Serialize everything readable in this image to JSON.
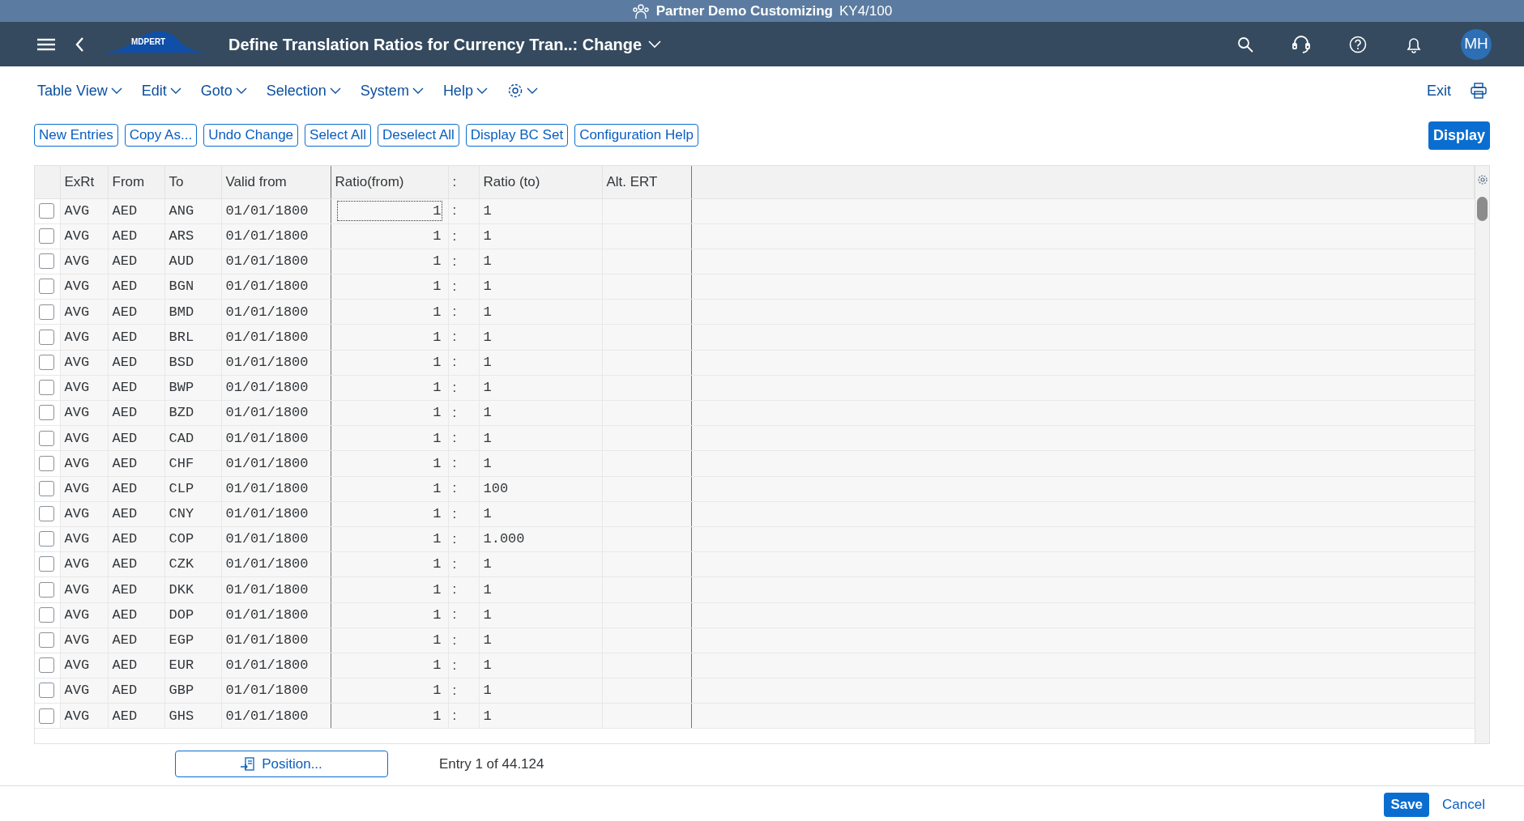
{
  "window": {
    "title": "Partner Demo Customizing",
    "system": "KY4/100"
  },
  "shell": {
    "logo": "MDPERT",
    "app_title": "Define Translation Ratios for Currency Tran..: Change",
    "avatar": "MH"
  },
  "menu": [
    "Table View",
    "Edit",
    "Goto",
    "Selection",
    "System",
    "Help"
  ],
  "exit": "Exit",
  "toolbar": [
    "New Entries",
    "Copy As...",
    "Undo Change",
    "Select All",
    "Deselect All",
    "Display BC Set",
    "Configuration Help"
  ],
  "display_button": "Display",
  "table": {
    "columns": [
      "ExRt",
      "From",
      "To",
      "Valid from",
      "Ratio(from)",
      ":",
      "Ratio (to)",
      "Alt. ERT"
    ],
    "rows": [
      {
        "selected": false,
        "focused": true,
        "cells": [
          "AVG",
          "AED",
          "ANG",
          "01/01/1800",
          "1",
          ":",
          "1",
          ""
        ]
      },
      {
        "selected": false,
        "focused": false,
        "cells": [
          "AVG",
          "AED",
          "ARS",
          "01/01/1800",
          "1",
          ":",
          "1",
          ""
        ]
      },
      {
        "selected": false,
        "focused": false,
        "cells": [
          "AVG",
          "AED",
          "AUD",
          "01/01/1800",
          "1",
          ":",
          "1",
          ""
        ]
      },
      {
        "selected": false,
        "focused": false,
        "cells": [
          "AVG",
          "AED",
          "BGN",
          "01/01/1800",
          "1",
          ":",
          "1",
          ""
        ]
      },
      {
        "selected": false,
        "focused": false,
        "cells": [
          "AVG",
          "AED",
          "BMD",
          "01/01/1800",
          "1",
          ":",
          "1",
          ""
        ]
      },
      {
        "selected": false,
        "focused": false,
        "cells": [
          "AVG",
          "AED",
          "BRL",
          "01/01/1800",
          "1",
          ":",
          "1",
          ""
        ]
      },
      {
        "selected": false,
        "focused": false,
        "cells": [
          "AVG",
          "AED",
          "BSD",
          "01/01/1800",
          "1",
          ":",
          "1",
          ""
        ]
      },
      {
        "selected": false,
        "focused": false,
        "cells": [
          "AVG",
          "AED",
          "BWP",
          "01/01/1800",
          "1",
          ":",
          "1",
          ""
        ]
      },
      {
        "selected": false,
        "focused": false,
        "cells": [
          "AVG",
          "AED",
          "BZD",
          "01/01/1800",
          "1",
          ":",
          "1",
          ""
        ]
      },
      {
        "selected": false,
        "focused": false,
        "cells": [
          "AVG",
          "AED",
          "CAD",
          "01/01/1800",
          "1",
          ":",
          "1",
          ""
        ]
      },
      {
        "selected": false,
        "focused": false,
        "cells": [
          "AVG",
          "AED",
          "CHF",
          "01/01/1800",
          "1",
          ":",
          "1",
          ""
        ]
      },
      {
        "selected": false,
        "focused": false,
        "cells": [
          "AVG",
          "AED",
          "CLP",
          "01/01/1800",
          "1",
          ":",
          "100",
          ""
        ]
      },
      {
        "selected": false,
        "focused": false,
        "cells": [
          "AVG",
          "AED",
          "CNY",
          "01/01/1800",
          "1",
          ":",
          "1",
          ""
        ]
      },
      {
        "selected": false,
        "focused": false,
        "cells": [
          "AVG",
          "AED",
          "COP",
          "01/01/1800",
          "1",
          ":",
          "1.000",
          ""
        ]
      },
      {
        "selected": false,
        "focused": false,
        "cells": [
          "AVG",
          "AED",
          "CZK",
          "01/01/1800",
          "1",
          ":",
          "1",
          ""
        ]
      },
      {
        "selected": false,
        "focused": false,
        "cells": [
          "AVG",
          "AED",
          "DKK",
          "01/01/1800",
          "1",
          ":",
          "1",
          ""
        ]
      },
      {
        "selected": false,
        "focused": false,
        "cells": [
          "AVG",
          "AED",
          "DOP",
          "01/01/1800",
          "1",
          ":",
          "1",
          ""
        ]
      },
      {
        "selected": false,
        "focused": false,
        "cells": [
          "AVG",
          "AED",
          "EGP",
          "01/01/1800",
          "1",
          ":",
          "1",
          ""
        ]
      },
      {
        "selected": false,
        "focused": false,
        "cells": [
          "AVG",
          "AED",
          "EUR",
          "01/01/1800",
          "1",
          ":",
          "1",
          ""
        ]
      },
      {
        "selected": false,
        "focused": false,
        "cells": [
          "AVG",
          "AED",
          "GBP",
          "01/01/1800",
          "1",
          ":",
          "1",
          ""
        ]
      },
      {
        "selected": false,
        "focused": false,
        "cells": [
          "AVG",
          "AED",
          "GHS",
          "01/01/1800",
          "1",
          ":",
          "1",
          ""
        ]
      }
    ]
  },
  "position_button": "Position...",
  "entry_info": "Entry 1 of 44.124",
  "footer": [
    "Save",
    "Cancel"
  ]
}
